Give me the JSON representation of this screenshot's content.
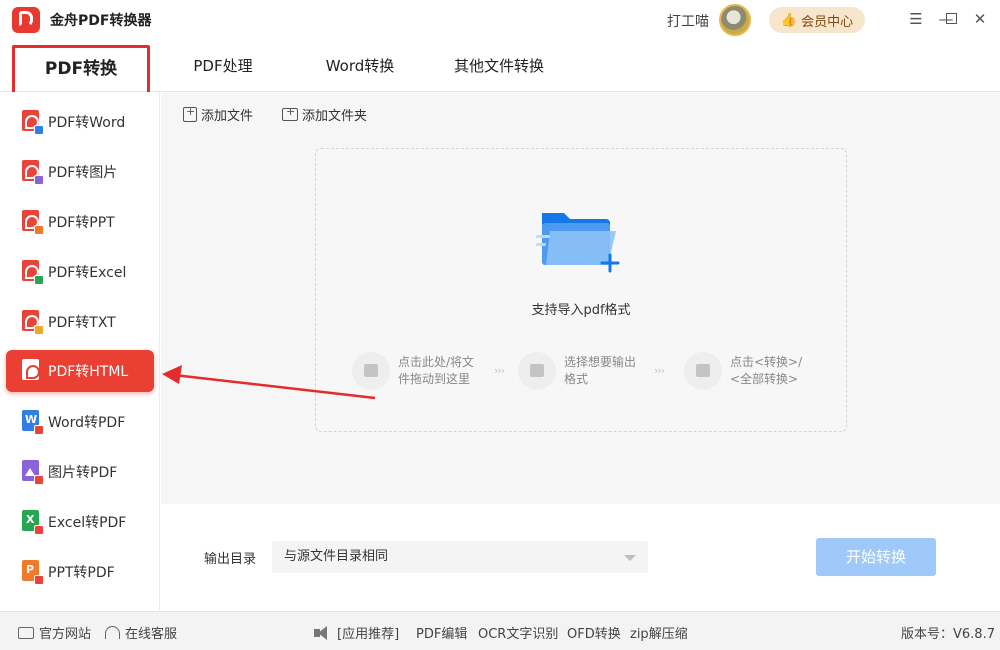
{
  "app": {
    "title": "金舟PDF转换器"
  },
  "header": {
    "username": "打工喵",
    "vip_label": "会员中心",
    "window_controls": [
      "menu-icon",
      "minimize-icon",
      "maximize-icon",
      "close-icon"
    ]
  },
  "tabs": [
    {
      "label": "PDF转换",
      "active": true
    },
    {
      "label": "PDF处理",
      "active": false
    },
    {
      "label": "Word转换",
      "active": false
    },
    {
      "label": "其他文件转换",
      "active": false
    }
  ],
  "sidebar": {
    "items": [
      {
        "label": "PDF转Word",
        "icon": "pdf-to-word-icon"
      },
      {
        "label": "PDF转图片",
        "icon": "pdf-to-image-icon"
      },
      {
        "label": "PDF转PPT",
        "icon": "pdf-to-ppt-icon"
      },
      {
        "label": "PDF转Excel",
        "icon": "pdf-to-excel-icon"
      },
      {
        "label": "PDF转TXT",
        "icon": "pdf-to-txt-icon"
      },
      {
        "label": "PDF转HTML",
        "icon": "pdf-to-html-icon",
        "active": true
      },
      {
        "label": "Word转PDF",
        "icon": "word-to-pdf-icon"
      },
      {
        "label": "图片转PDF",
        "icon": "image-to-pdf-icon"
      },
      {
        "label": "Excel转PDF",
        "icon": "excel-to-pdf-icon"
      },
      {
        "label": "PPT转PDF",
        "icon": "ppt-to-pdf-icon"
      }
    ]
  },
  "toolbar": {
    "add_file": "添加文件",
    "add_folder": "添加文件夹"
  },
  "dropzone": {
    "hint": "支持导入pdf格式",
    "steps": [
      {
        "line1": "点击此处/将文",
        "line2": "件拖动到这里"
      },
      {
        "line1": "选择想要输出",
        "line2": "格式"
      },
      {
        "line1": "点击<转换>/",
        "line2": "<全部转换>"
      }
    ]
  },
  "output": {
    "label": "输出目录",
    "selected": "与源文件目录相同"
  },
  "start_button": "开始转换",
  "footer": {
    "website": "官方网站",
    "support": "在线客服",
    "recommend": "[应用推荐]",
    "links": [
      "PDF编辑",
      "OCR文字识别",
      "OFD转换",
      "zip解压缩"
    ],
    "version": "版本号：V6.8.7"
  },
  "colors": {
    "accent_red": "#ea3f33",
    "start_button_bg": "#9ec9f8",
    "vip_bg": "#f7e6cc",
    "folder_blue": "#1677e8"
  }
}
